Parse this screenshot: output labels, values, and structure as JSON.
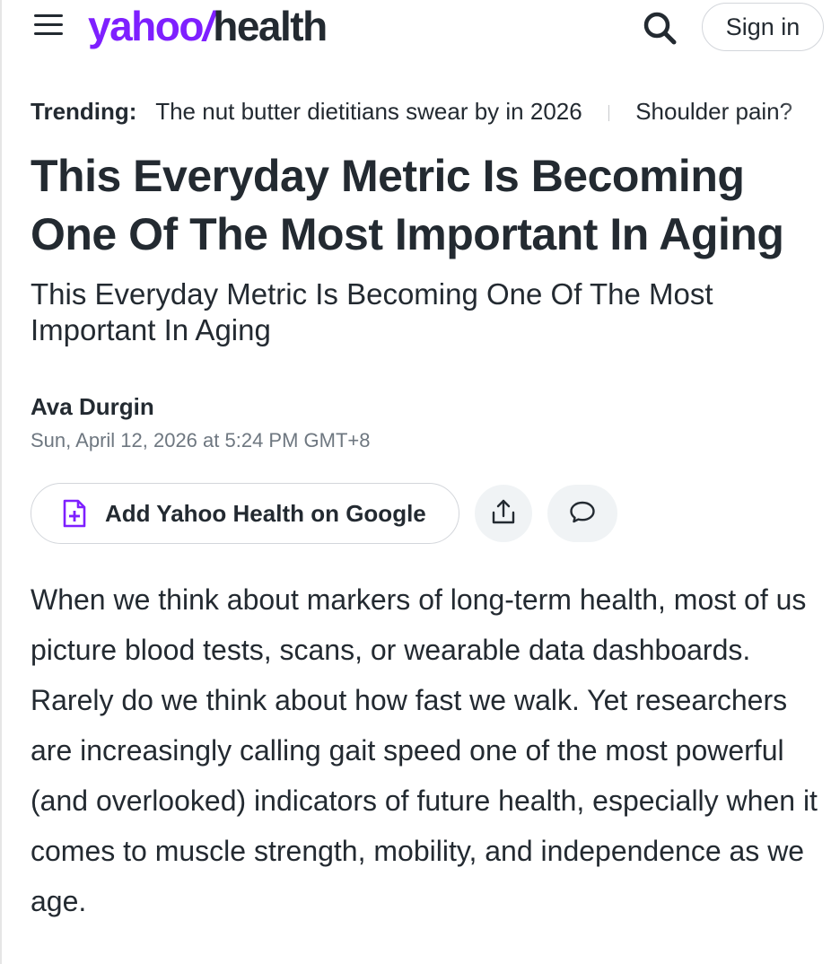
{
  "header": {
    "logo_brand": "yahoo",
    "logo_excl": "/",
    "logo_section": "health",
    "sign_in_label": "Sign in"
  },
  "trending": {
    "label": "Trending:",
    "items": [
      "The nut butter dietitians swear by in 2026",
      "Shoulder pain?"
    ]
  },
  "article": {
    "title": "This Everyday Metric Is Becoming One Of The Most Important In Aging",
    "subtitle": "This Everyday Metric Is Becoming One Of The Most Important In Aging",
    "author": "Ava Durgin",
    "date": "Sun, April 12, 2026 at 5:24 PM GMT+8",
    "body": "When we think about markers of long-term health, most of us picture blood tests, scans, or wearable data dashboards. Rarely do we think about how fast we walk. Yet researchers are increasingly calling gait speed one of the most powerful (and overlooked) indicators of future health, especially when it comes to muscle strength, mobility, and independence as we age."
  },
  "actions": {
    "google_label": "Add Yahoo Health on Google",
    "icons": [
      "document-plus-icon",
      "share-icon",
      "comment-icon"
    ]
  },
  "colors": {
    "brand_purple": "#7e1fff",
    "text": "#232a31",
    "muted": "#6e7780",
    "button_bg": "#f0f3f5"
  }
}
